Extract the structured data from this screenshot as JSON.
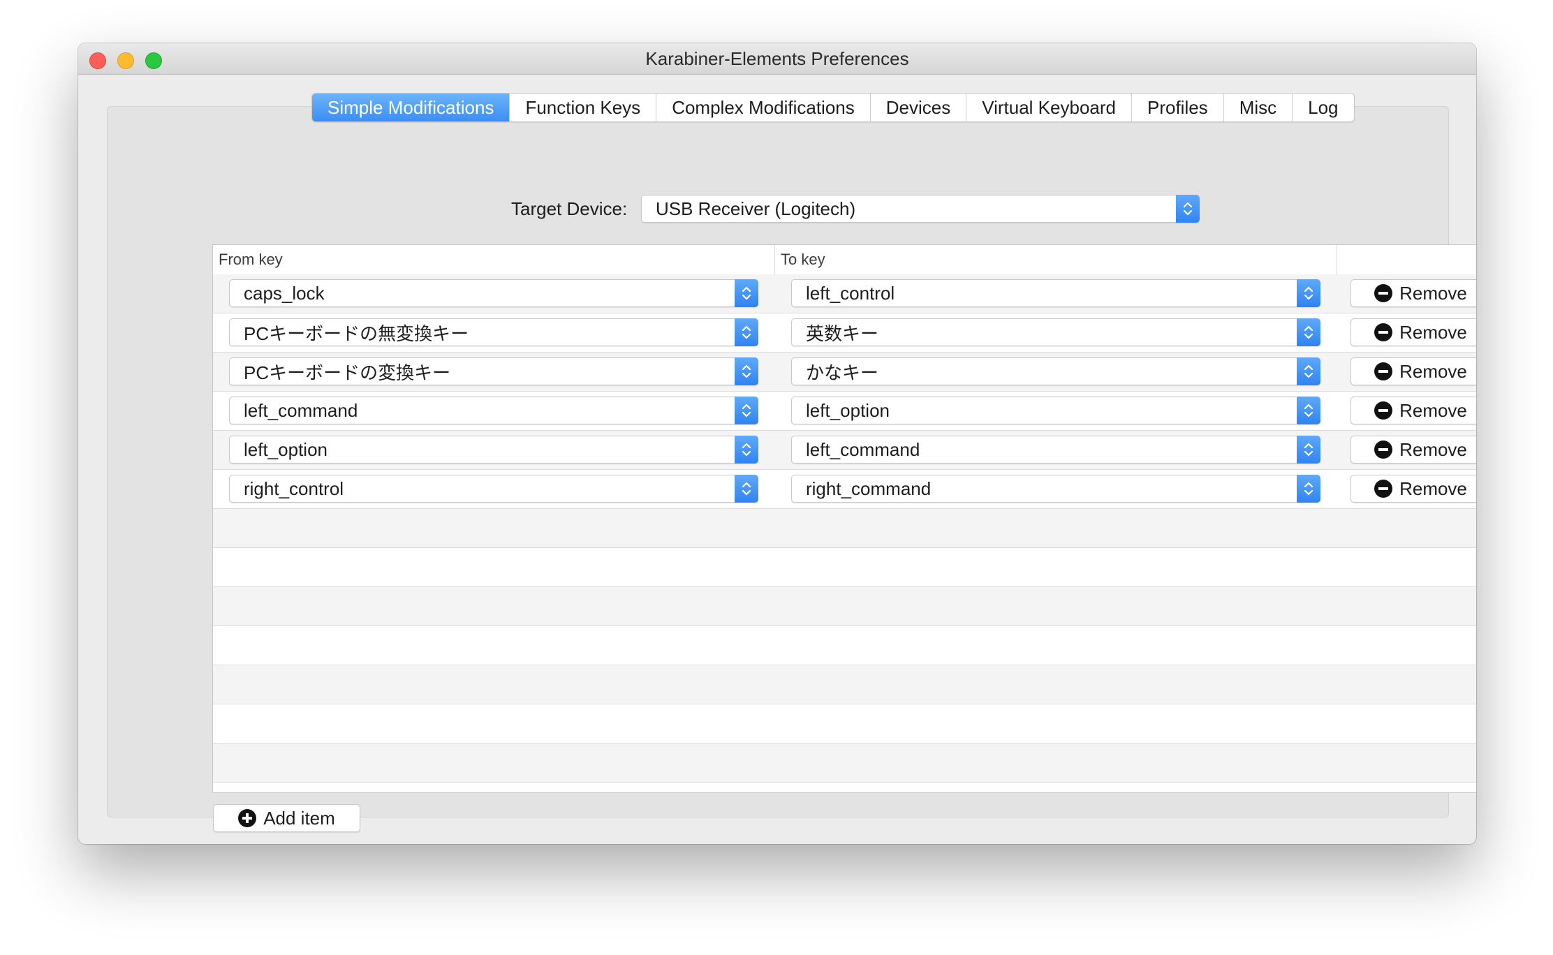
{
  "window": {
    "title": "Karabiner-Elements Preferences"
  },
  "tabs": [
    {
      "label": "Simple Modifications",
      "active": true
    },
    {
      "label": "Function Keys",
      "active": false
    },
    {
      "label": "Complex Modifications",
      "active": false
    },
    {
      "label": "Devices",
      "active": false
    },
    {
      "label": "Virtual Keyboard",
      "active": false
    },
    {
      "label": "Profiles",
      "active": false
    },
    {
      "label": "Misc",
      "active": false
    },
    {
      "label": "Log",
      "active": false
    }
  ],
  "target_device": {
    "label": "Target Device:",
    "value": "USB Receiver (Logitech)"
  },
  "table": {
    "columns": {
      "from": "From key",
      "to": "To key",
      "action": ""
    },
    "rows": [
      {
        "from": "caps_lock",
        "to": "left_control",
        "action": "Remove"
      },
      {
        "from": "PCキーボードの無変換キー",
        "to": "英数キー",
        "action": "Remove"
      },
      {
        "from": "PCキーボードの変換キー",
        "to": "かなキー",
        "action": "Remove"
      },
      {
        "from": "left_command",
        "to": "left_option",
        "action": "Remove"
      },
      {
        "from": "left_option",
        "to": "left_command",
        "action": "Remove"
      },
      {
        "from": "right_control",
        "to": "right_command",
        "action": "Remove"
      }
    ]
  },
  "add_item": {
    "label": "Add item"
  },
  "icons": {
    "remove": "minus-circle-icon",
    "add": "plus-circle-icon",
    "popup_arrows": "up-down-chevron-icon"
  },
  "colors": {
    "accent": "#3a8ef6",
    "close": "#fc5f57",
    "minimize": "#fdbc2e",
    "zoom": "#28c840"
  }
}
